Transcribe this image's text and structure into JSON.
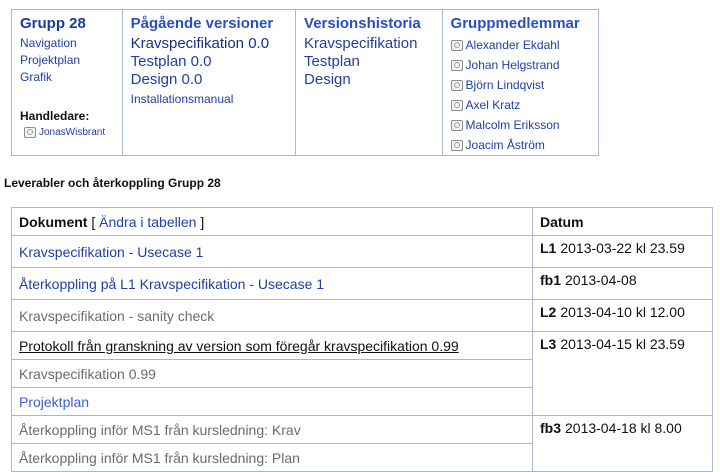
{
  "nav": {
    "group": {
      "title": "Grupp 28",
      "links": [
        "Navigation",
        "Projektplan",
        "Grafik"
      ],
      "supervisor_label": "Handledare:",
      "supervisor": "JonasWisbrant"
    },
    "current": {
      "title": "Pågående versioner",
      "links": [
        "Kravspecifikation 0.0",
        "Testplan 0.0",
        "Design 0.0"
      ],
      "extra": "Installationsmanual"
    },
    "history": {
      "title": "Versionshistoria",
      "links": [
        "Kravspecifikation",
        "Testplan",
        "Design"
      ]
    },
    "members": {
      "title": "Gruppmedlemmar",
      "names": [
        "Alexander Ekdahl",
        "Johan Helgstrand",
        "Björn Lindqvist",
        "Axel Kratz",
        "Malcolm Eriksson",
        "Joacim Åström"
      ]
    }
  },
  "section_title": "Leverabler och återkoppling Grupp 28",
  "table": {
    "header_doc": "Dokument",
    "bracket_open": "[",
    "edit_label": "Ändra i tabellen",
    "bracket_close": "]",
    "header_date": "Datum",
    "rows": [
      {
        "doc": "Kravspecifikation - Usecase 1",
        "code": "L1",
        "date": "2013-03-22 kl 23.59"
      },
      {
        "doc": "Återkoppling på L1 Kravspecifikation - Usecase 1",
        "code": "fb1",
        "date": "2013-04-08"
      },
      {
        "doc": "Kravspecifikation - sanity check",
        "code": "L2",
        "date": "2013-04-10 kl 12.00"
      },
      {
        "doc": "Protokoll från granskning av version som föregår kravspecifikation 0.99",
        "code": "L3",
        "date": "2013-04-15 kl 23.59"
      },
      {
        "doc": "Kravspecifikation 0.99"
      },
      {
        "doc": "Projektplan"
      },
      {
        "doc": "Återkoppling inför MS1 från kursledning: Krav",
        "code": "fb3",
        "date": "2013-04-18 kl 8.00"
      },
      {
        "doc": "Återkoppling inför MS1 från kursledning: Plan"
      }
    ]
  }
}
